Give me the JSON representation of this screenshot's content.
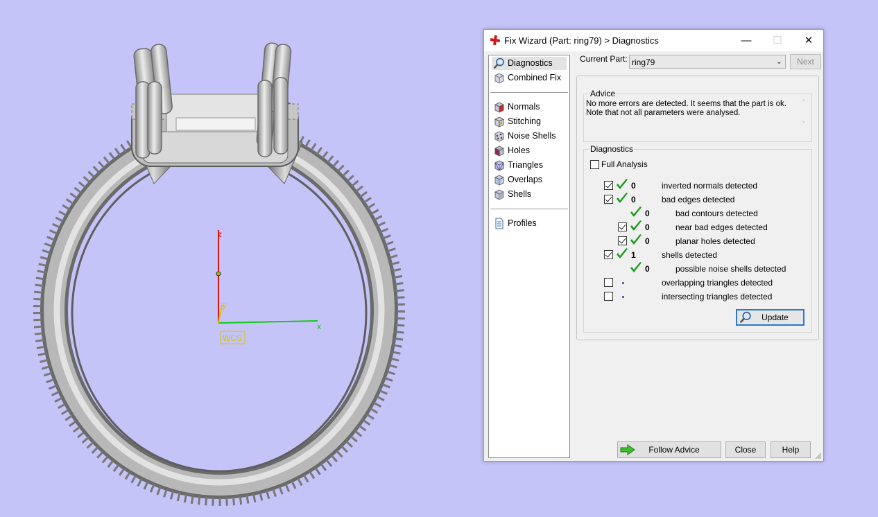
{
  "viewport": {
    "background": "#c4c4f8",
    "axes": {
      "z_label": "z",
      "y_label": "y",
      "x_label": "x",
      "frame_label": "WCS"
    }
  },
  "dialog": {
    "title": "Fix Wizard (Part: ring79) > Diagnostics",
    "window_buttons": {
      "minimize": "—",
      "maximize": "☐",
      "close": "✕"
    },
    "nav": {
      "group1": [
        {
          "label": "Diagnostics",
          "icon": "magnifier-icon",
          "selected": true
        },
        {
          "label": "Combined Fix",
          "icon": "box-icon"
        }
      ],
      "group2": [
        {
          "label": "Normals",
          "icon": "normals-cube-icon"
        },
        {
          "label": "Stitching",
          "icon": "stitching-cube-icon"
        },
        {
          "label": "Noise Shells",
          "icon": "noise-shells-icon"
        },
        {
          "label": "Holes",
          "icon": "holes-cube-icon"
        },
        {
          "label": "Triangles",
          "icon": "triangles-cube-icon"
        },
        {
          "label": "Overlaps",
          "icon": "overlaps-cube-icon"
        },
        {
          "label": "Shells",
          "icon": "shells-cube-icon"
        }
      ],
      "group3": [
        {
          "label": "Profiles",
          "icon": "document-icon"
        }
      ]
    },
    "current_part_label": "Current Part:",
    "current_part_value": "ring79",
    "next_label": "Next",
    "advice": {
      "title": "Advice",
      "line1": "No more errors are detected. It seems that the part is ok.",
      "line2": "Note that not all parameters were analysed."
    },
    "diagnostics": {
      "title": "Diagnostics",
      "full_analysis_label": "Full Analysis",
      "full_analysis_checked": false,
      "rows": [
        {
          "checked": true,
          "status": "ok",
          "count": "0",
          "label": "inverted normals detected",
          "level": 0
        },
        {
          "checked": true,
          "status": "ok",
          "count": "0",
          "label": "bad edges detected",
          "level": 0
        },
        {
          "checked": null,
          "status": "ok",
          "count": "0",
          "label": "bad contours detected",
          "level": 1
        },
        {
          "checked": true,
          "status": "ok",
          "count": "0",
          "label": "near bad edges detected",
          "level": 1
        },
        {
          "checked": true,
          "status": "ok",
          "count": "0",
          "label": "planar holes detected",
          "level": 1
        },
        {
          "checked": true,
          "status": "ok",
          "count": "1",
          "label": "shells detected",
          "level": 0
        },
        {
          "checked": null,
          "status": "ok",
          "count": "0",
          "label": "possible noise shells detected",
          "level": 1
        },
        {
          "checked": false,
          "status": "pending",
          "count": "",
          "label": "overlapping triangles detected",
          "level": 0
        },
        {
          "checked": false,
          "status": "pending",
          "count": "",
          "label": "intersecting triangles detected",
          "level": 0
        }
      ],
      "update_label": "Update"
    },
    "footer": {
      "follow_advice": "Follow Advice",
      "close": "Close",
      "help": "Help"
    },
    "colors": {
      "tick_green": "#1a9a1a",
      "focus_blue": "#2a78d2",
      "pending_dot": "#2d3fbb"
    }
  }
}
